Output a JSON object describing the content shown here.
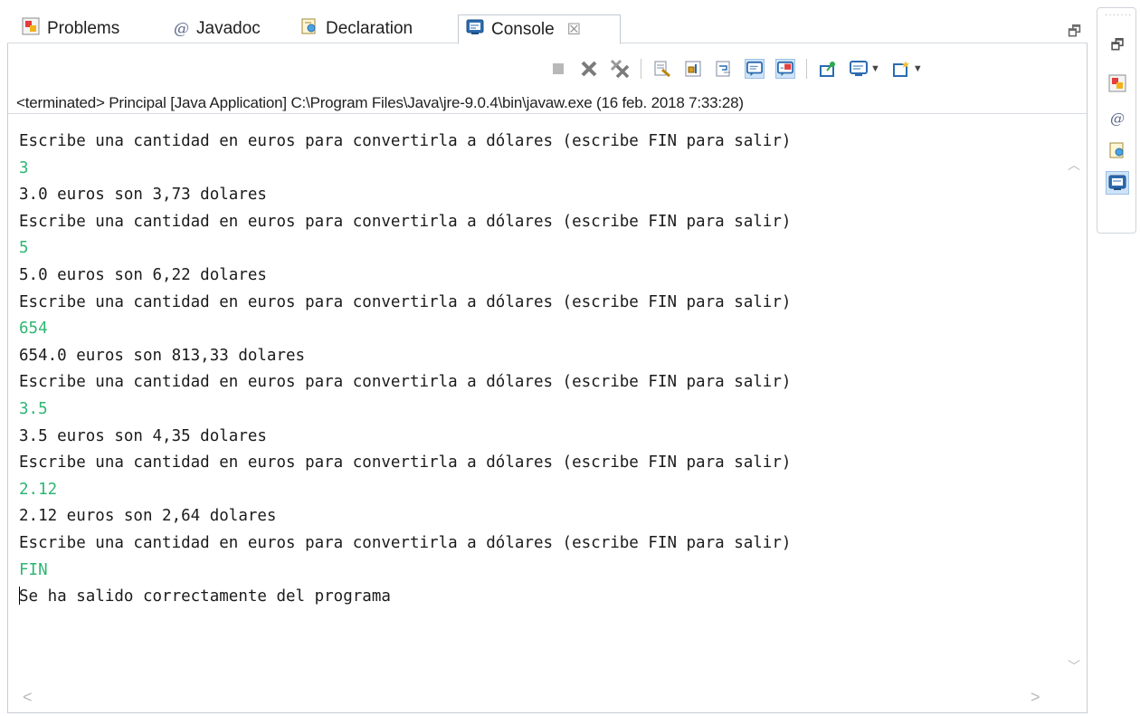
{
  "tabs": [
    {
      "label": "Problems",
      "icon": "problems-icon",
      "active": false
    },
    {
      "label": "Javadoc",
      "icon": "javadoc-icon",
      "active": false
    },
    {
      "label": "Declaration",
      "icon": "declaration-icon",
      "active": false
    },
    {
      "label": "Console",
      "icon": "console-icon",
      "active": true,
      "close": "☒"
    }
  ],
  "status": "<terminated> Principal [Java Application] C:\\Program Files\\Java\\jre-9.0.4\\bin\\javaw.exe (16 feb. 2018 7:33:28)",
  "console": {
    "lines": [
      {
        "text": "Escribe una cantidad en euros para convertirla a dólares (escribe FIN para salir)",
        "kind": "output"
      },
      {
        "text": "3",
        "kind": "input"
      },
      {
        "text": "3.0 euros son 3,73 dolares",
        "kind": "output"
      },
      {
        "text": "Escribe una cantidad en euros para convertirla a dólares (escribe FIN para salir)",
        "kind": "output"
      },
      {
        "text": "5",
        "kind": "input"
      },
      {
        "text": "5.0 euros son 6,22 dolares",
        "kind": "output"
      },
      {
        "text": "Escribe una cantidad en euros para convertirla a dólares (escribe FIN para salir)",
        "kind": "output"
      },
      {
        "text": "654",
        "kind": "input"
      },
      {
        "text": "654.0 euros son 813,33 dolares",
        "kind": "output"
      },
      {
        "text": "Escribe una cantidad en euros para convertirla a dólares (escribe FIN para salir)",
        "kind": "output"
      },
      {
        "text": "3.5",
        "kind": "input"
      },
      {
        "text": "3.5 euros son 4,35 dolares",
        "kind": "output"
      },
      {
        "text": "Escribe una cantidad en euros para convertirla a dólares (escribe FIN para salir)",
        "kind": "output"
      },
      {
        "text": "2.12",
        "kind": "input"
      },
      {
        "text": "2.12 euros son 2,64 dolares",
        "kind": "output"
      },
      {
        "text": "Escribe una cantidad en euros para convertirla a dólares (escribe FIN para salir)",
        "kind": "output"
      },
      {
        "text": "FIN",
        "kind": "input"
      },
      {
        "text": "Se ha salido correctamente del programa",
        "kind": "output"
      }
    ],
    "input_color": "#2fb673",
    "output_color": "#1b1b1b"
  },
  "toolbar_icons": [
    "terminate-icon",
    "remove-launch-icon",
    "remove-all-terminated-icon",
    "clear-console-icon",
    "scroll-lock-icon",
    "word-wrap-icon",
    "show-on-stdout-icon",
    "show-on-stderr-icon",
    "pin-console-icon",
    "display-console-icon",
    "open-console-icon"
  ],
  "trim_icons": [
    "restore-icon",
    "problems-icon",
    "javadoc-icon",
    "declaration-icon",
    "console-icon"
  ]
}
